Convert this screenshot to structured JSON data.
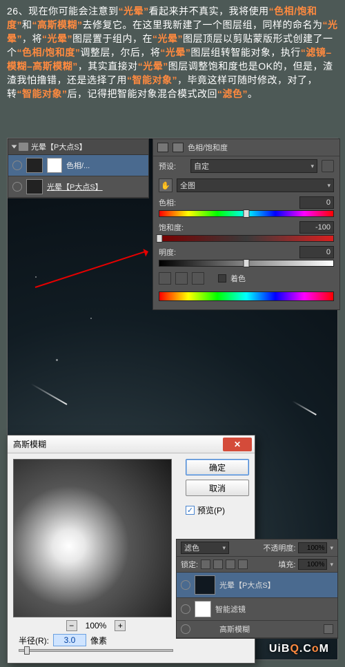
{
  "paragraph": {
    "step": "26、",
    "t1": "现在你可能会注意到",
    "q1": "“光晕”",
    "t2": "看起来并不真实，我将使用",
    "q2": "“色相/饱和度”",
    "t3": "和",
    "q3": "“高斯模糊”",
    "t4": "去修复它。在这里我新建了一个图层组，同样的命名为",
    "q4": "“光晕”",
    "t5": "，将",
    "q5": "“光晕”",
    "t6": "图层置于组内，在",
    "q6": "“光晕”",
    "t7": "图层顶层以剪贴蒙版形式创建了一个",
    "q7": "“色相/饱和度”",
    "t8": "调整层，尔后，将",
    "q8": "“光晕”",
    "t9": "图层组转智能对象，执行",
    "q9": "“滤镜–模糊–高斯模糊”",
    "t10": "，其实直接对",
    "q10": "“光晕”",
    "t11": "图层调整饱和度也是OK的，但是，渣渣我怕撸错，还是选择了用",
    "q11": "“智能对象”",
    "t12": "，毕竟这样可随时修改，对了，转",
    "q12": "“智能对象”",
    "t13": "后，记得把智能对象混合模式改回",
    "q13": "“滤色”",
    "t14": "。"
  },
  "layers_mini": {
    "group": "光晕【P大点S】",
    "adj": "色相/...",
    "layer": "光晕【P大点S】"
  },
  "hue_sat": {
    "title": "色相/饱和度",
    "preset_label": "预设:",
    "preset_value": "自定",
    "range_value": "全图",
    "hue_label": "色相:",
    "hue_value": "0",
    "sat_label": "饱和度:",
    "sat_value": "-100",
    "lum_label": "明度:",
    "lum_value": "0",
    "colorize": "着色"
  },
  "gauss": {
    "title": "高斯模糊",
    "ok": "确定",
    "cancel": "取消",
    "preview": "预览(P)",
    "zoom": "100%",
    "radius_label": "半径(R):",
    "radius_value": "3.0",
    "radius_unit": "像素"
  },
  "layers_big": {
    "blend_mode": "滤色",
    "opacity_label": "不透明度:",
    "opacity_value": "100%",
    "lock_label": "锁定:",
    "fill_label": "填充:",
    "fill_value": "100%",
    "layer_name": "光晕【P大点S】",
    "smart_filters": "智能滤镜",
    "filter_name": "高斯模糊"
  },
  "watermark": {
    "a": "UiB",
    "b": "Q",
    "c": ".C",
    "d": "o",
    "e": "M"
  }
}
